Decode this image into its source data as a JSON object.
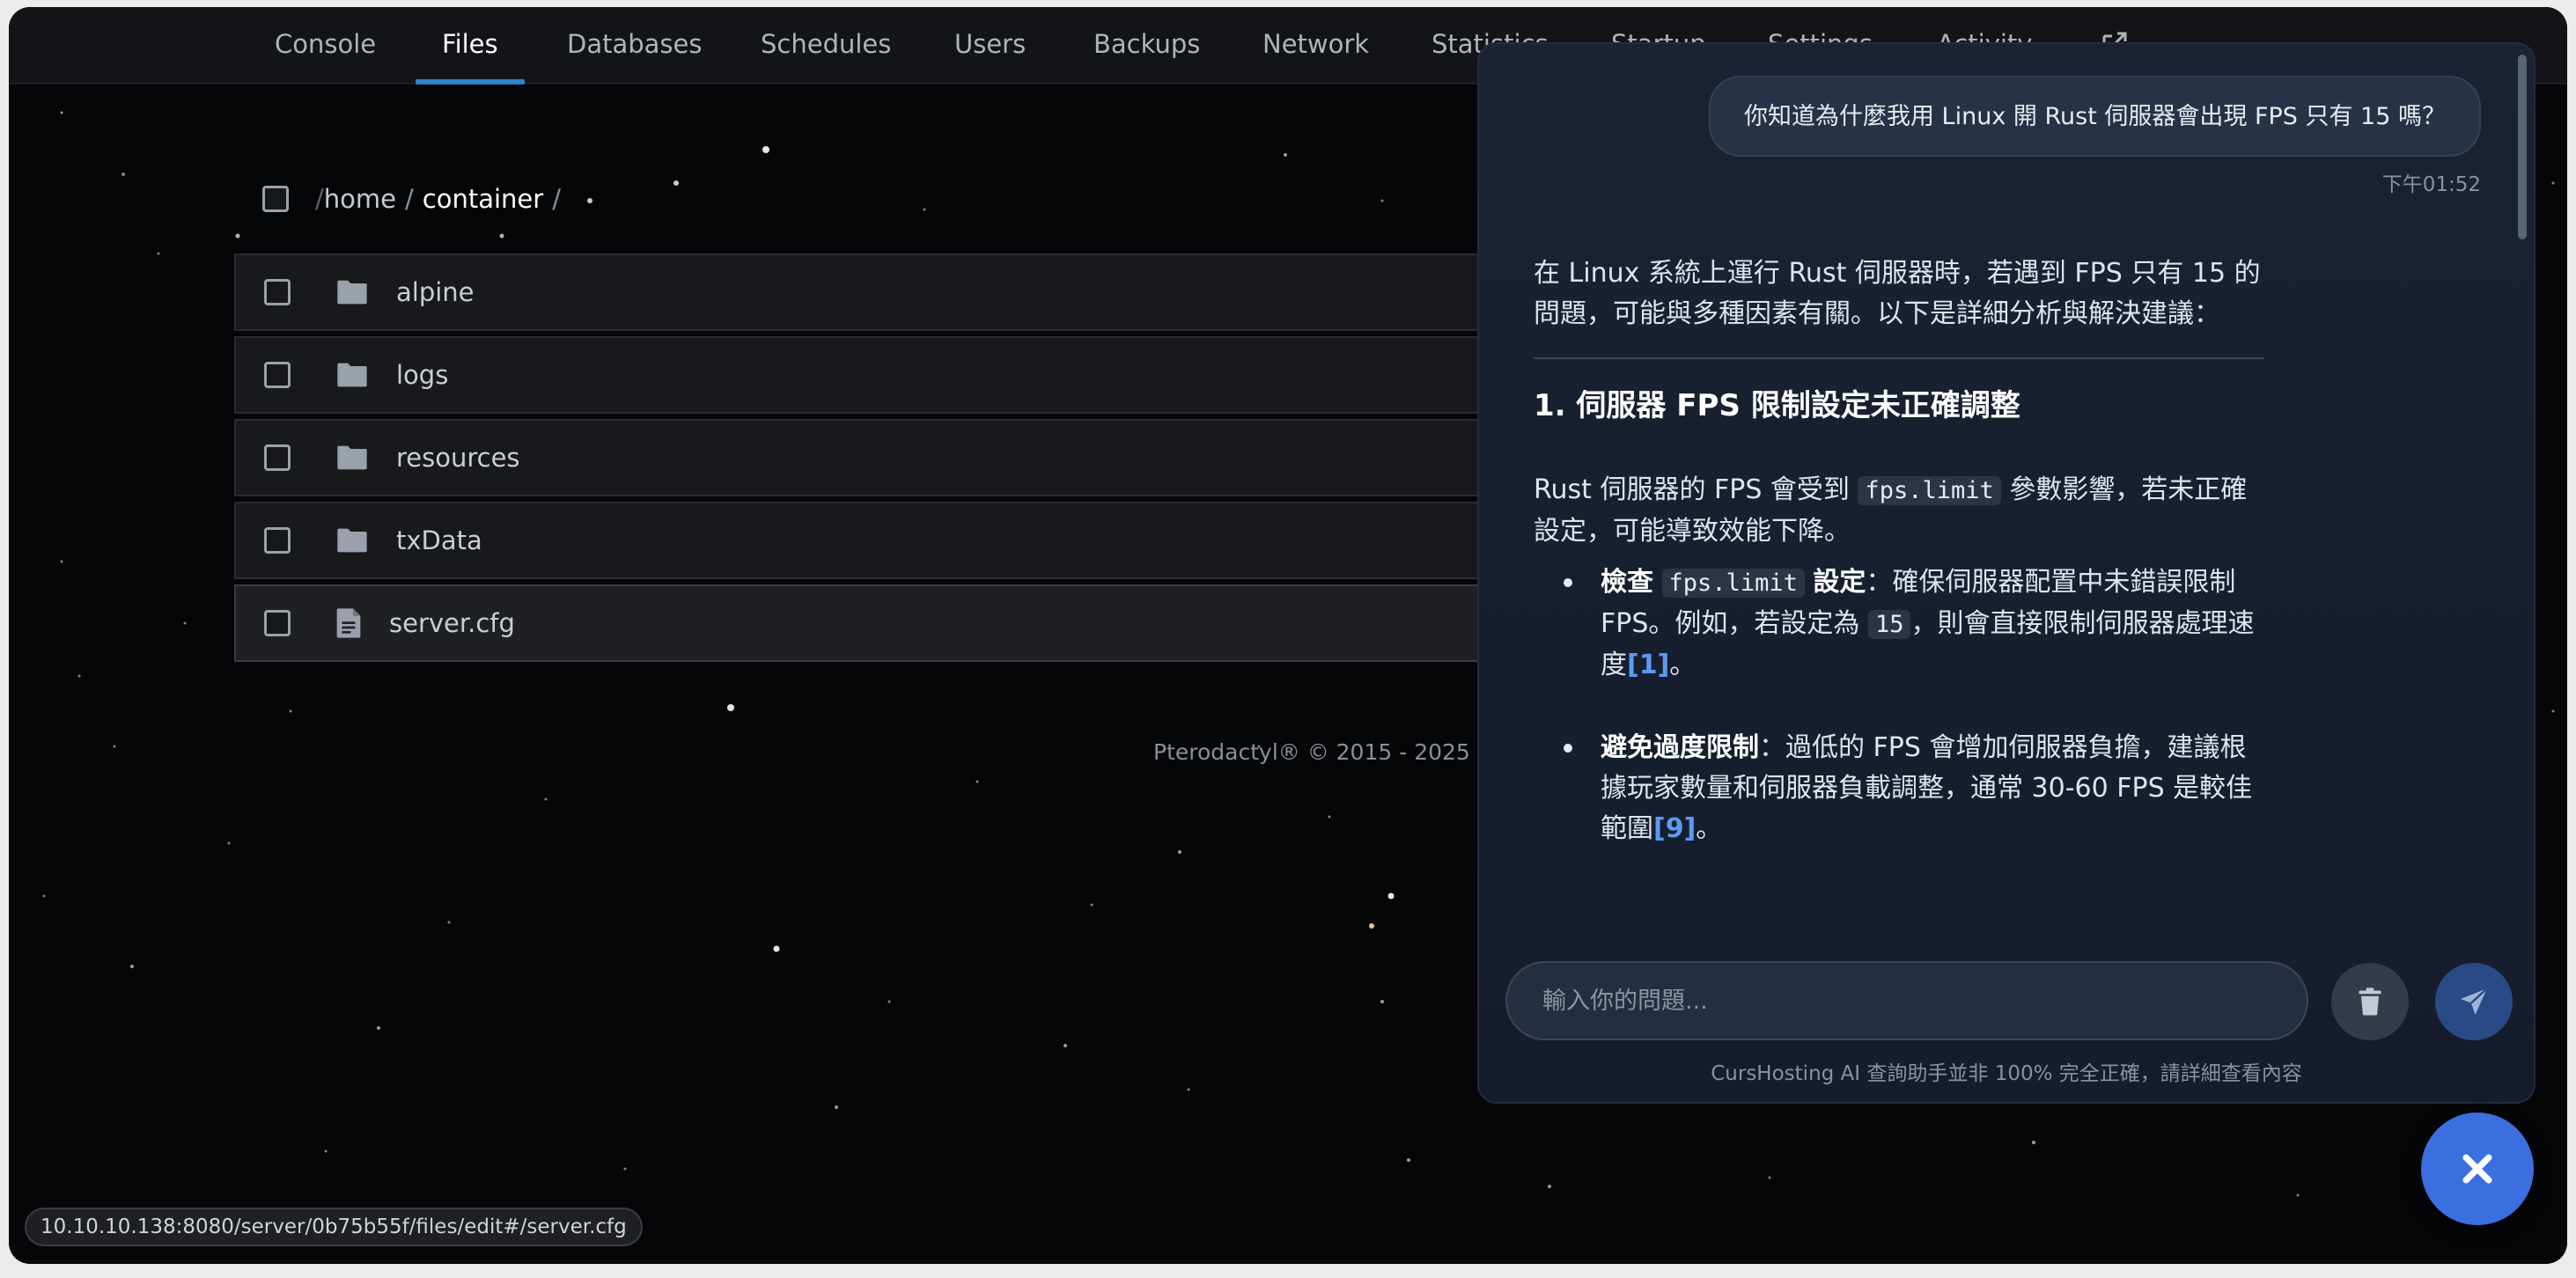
{
  "nav": {
    "tabs": [
      {
        "label": "Console",
        "active": false
      },
      {
        "label": "Files",
        "active": true
      },
      {
        "label": "Databases",
        "active": false
      },
      {
        "label": "Schedules",
        "active": false
      },
      {
        "label": "Users",
        "active": false
      },
      {
        "label": "Backups",
        "active": false
      },
      {
        "label": "Network",
        "active": false
      },
      {
        "label": "Statistics",
        "active": false
      },
      {
        "label": "Startup",
        "active": false
      },
      {
        "label": "Settings",
        "active": false
      },
      {
        "label": "Activity",
        "active": false
      }
    ],
    "external_icon": "external-link-icon"
  },
  "breadcrumb": {
    "root": "/",
    "home": "home",
    "separator": "/",
    "current": "container"
  },
  "files": [
    {
      "name": "alpine",
      "type": "folder",
      "icon": "folder-icon"
    },
    {
      "name": "logs",
      "type": "folder",
      "icon": "folder-icon"
    },
    {
      "name": "resources",
      "type": "folder",
      "icon": "folder-icon"
    },
    {
      "name": "txData",
      "type": "folder",
      "icon": "folder-icon"
    },
    {
      "name": "server.cfg",
      "type": "file",
      "icon": "file-text-icon"
    }
  ],
  "footer": {
    "copyright": "Pterodactyl® © 2015 - 2025"
  },
  "status_url": "10.10.10.138:8080/server/0b75b55f/files/edit#/server.cfg",
  "chat": {
    "user_message": "你知道為什麼我用 Linux 開 Rust 伺服器會出現 FPS 只有 15 嗎？",
    "user_time": "下午01:52",
    "reply": {
      "intro": "在 Linux 系統上運行 Rust 伺服器時，若遇到 FPS 只有 15 的問題，可能與多種因素有關。以下是詳細分析與解決建議：",
      "heading": "1. 伺服器 FPS 限制設定未正確調整",
      "para_a": "Rust 伺服器的 FPS 會受到",
      "para_code": "fps.limit",
      "para_b": "參數影響，若未正確設定，可能導致效能下降。",
      "b1_bold_a": "檢查",
      "b1_code": "fps.limit",
      "b1_bold_b": "設定",
      "b1_text_a": "：確保伺服器配置中未錯誤限制 FPS。例如，若設定為",
      "b1_code2": "15",
      "b1_text_b": "，則會直接限制伺服器處理速度",
      "b1_ref": "[1]",
      "b1_end": "。",
      "b2_bold": "避免過度限制",
      "b2_text": "：過低的 FPS 會增加伺服器負擔，建議根據玩家數量和伺服器負載調整，通常 30-60 FPS 是較佳範圍",
      "b2_ref": "[9]",
      "b2_end": "。"
    },
    "input_placeholder": "輸入你的問題...",
    "trash_icon": "trash-icon",
    "send_icon": "send-icon",
    "disclaimer": "CursHosting AI 查詢助手並非 100% 完全正確，請詳細查看內容"
  },
  "close_icon": "close-icon",
  "colors": {
    "background": "#050608",
    "nav_bg": "#131417",
    "accent": "#2f84c9",
    "chat_bg": "#1a2233",
    "send_button": "#2a4a86",
    "close_fab": "#3b6fe0",
    "reference_link": "#5b9bf0"
  }
}
